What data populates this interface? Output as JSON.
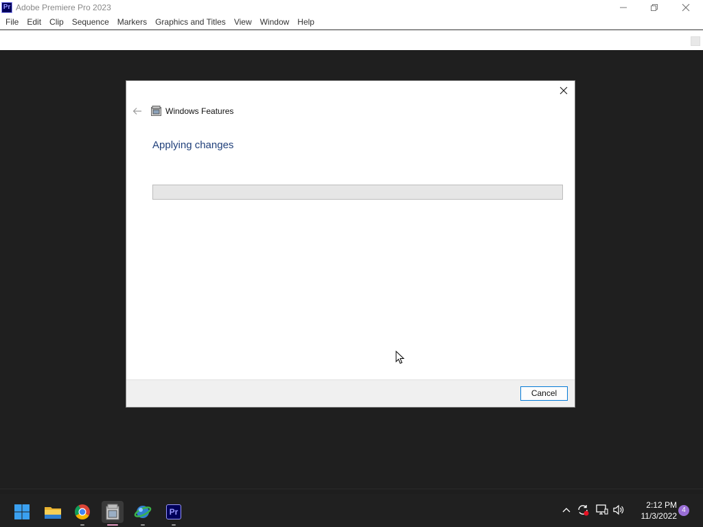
{
  "window": {
    "app_icon_text": "Pr",
    "title": "Adobe Premiere Pro 2023"
  },
  "menu": [
    "File",
    "Edit",
    "Clip",
    "Sequence",
    "Markers",
    "Graphics and Titles",
    "View",
    "Window",
    "Help"
  ],
  "dialog": {
    "title": "Windows Features",
    "heading": "Applying changes",
    "progress_percent": 0,
    "cancel_label": "Cancel"
  },
  "taskbar": {
    "apps": [
      "start-icon",
      "file-explorer-icon",
      "chrome-icon",
      "windows-features-icon",
      "network-app-icon",
      "premiere-pro-icon"
    ],
    "active_app": "windows-features-icon",
    "premiere_icon_text": "Pr",
    "clock_time": "2:12 PM",
    "clock_date": "11/3/2022",
    "notification_count": "4"
  },
  "colors": {
    "accent": "#0078d7",
    "heading": "#1f3f7a",
    "premiere_bg": "#00005b",
    "premiere_fg": "#9999ff"
  }
}
